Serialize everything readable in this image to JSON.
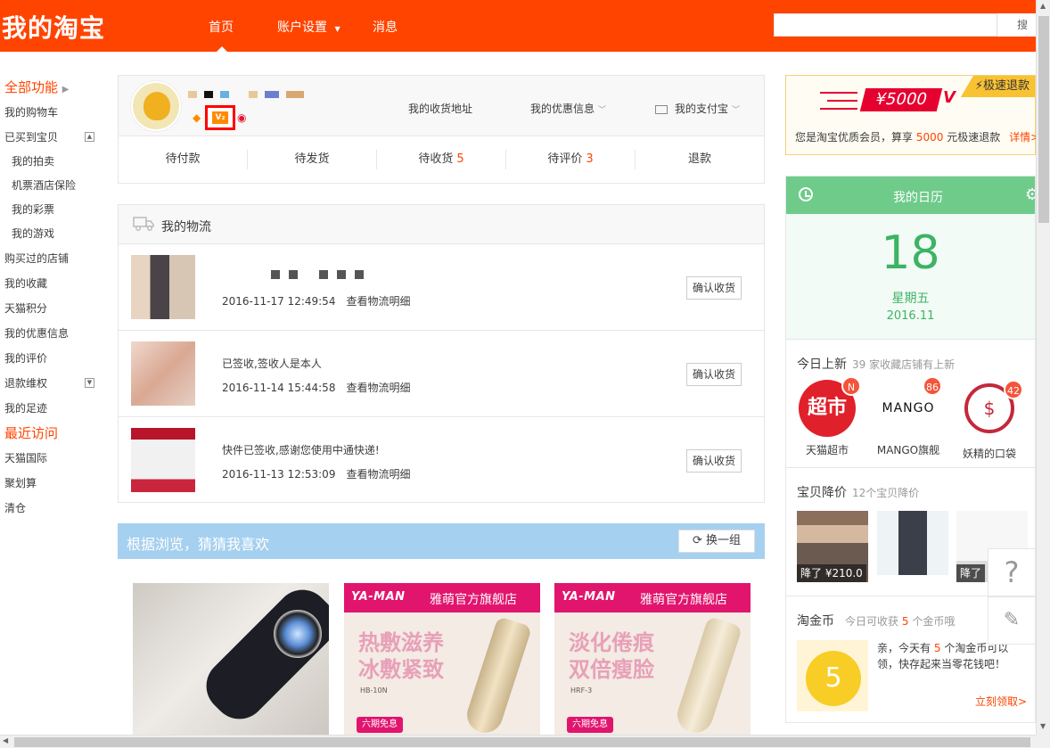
{
  "header": {
    "logo": "我的淘宝",
    "nav": [
      {
        "label": "首页",
        "active": true
      },
      {
        "label": "账户设置",
        "dropdown": true
      },
      {
        "label": "消息"
      }
    ],
    "search_button": "搜 索",
    "brand_color": "#ff4400"
  },
  "sidebar": {
    "section1": "全部功能",
    "items": [
      "我的购物车",
      "已买到宝贝",
      "我的拍卖",
      "机票酒店保险",
      "我的彩票",
      "我的游戏",
      "购买过的店铺",
      "我的收藏",
      "天猫积分",
      "我的优惠信息",
      "我的评价",
      "退款维权",
      "我的足迹"
    ],
    "section2": "最近访问",
    "recent": [
      "天猫国际",
      "聚划算",
      "清仓"
    ]
  },
  "profile": {
    "vip_badge": "V₂",
    "links": {
      "address": "我的收货地址",
      "coupons": "我的优惠信息",
      "alipay": "我的支付宝"
    },
    "order_tabs": [
      {
        "label": "待付款",
        "count": ""
      },
      {
        "label": "待发货",
        "count": ""
      },
      {
        "label": "待收货",
        "count": "5"
      },
      {
        "label": "待评价",
        "count": "3"
      },
      {
        "label": "退款",
        "count": ""
      }
    ]
  },
  "logistics": {
    "title": "我的物流",
    "detail_link": "查看物流明细",
    "confirm": "确认收货",
    "rows": [
      {
        "message": "",
        "time": "2016-11-17 12:49:54"
      },
      {
        "message": "已签收,签收人是本人",
        "time": "2016-11-14 15:44:58"
      },
      {
        "message": "快件已签收,感谢您使用中通快递!",
        "time": "2016-11-13 12:53:09"
      }
    ]
  },
  "guess": {
    "title": "根据浏览，猜猜我喜欢",
    "refresh": "换一组",
    "products": [
      {},
      {
        "brand": "YA-MAN",
        "store": "雅萌官方旗舰店",
        "slogan1": "热敷滋养",
        "slogan2": "冰敷紧致",
        "model": "HB-10N",
        "promo": "六期免息"
      },
      {
        "brand": "YA-MAN",
        "store": "雅萌官方旗舰店",
        "slogan1": "淡化倦痕",
        "slogan2": "双倍瘦脸",
        "model": "HRF-3",
        "promo": "六期免息"
      }
    ]
  },
  "refund": {
    "corner": "极速退款",
    "amount": "¥5000",
    "text_pre": "您是淘宝优质会员，算享",
    "text_amt": "5000",
    "text_post": "元极速退款",
    "more": "详情>"
  },
  "calendar": {
    "title": "我的日历",
    "day": "18",
    "weekday": "星期五",
    "month": "2016.11"
  },
  "new_today": {
    "title": "今日上新",
    "sub_count": "39",
    "sub_text": "家收藏店铺有上新",
    "shops": [
      {
        "name": "天猫超市",
        "badge": "N",
        "logo_text": "超市"
      },
      {
        "name": "MANGO旗舰",
        "badge": "86",
        "logo_text": "MANGO"
      },
      {
        "name": "妖精的口袋",
        "badge": "42",
        "logo_text": "$"
      }
    ]
  },
  "price_drop": {
    "title": "宝贝降价",
    "sub": "12个宝贝降价",
    "items": [
      {
        "label": "降了 ¥210.0"
      },
      {
        "label": ""
      },
      {
        "label": "降了"
      }
    ]
  },
  "coins": {
    "title": "淘金币",
    "sub_pre": "今日可收获",
    "sub_num": "5",
    "sub_post": "个金币哦",
    "amount": "5",
    "text_pre": "亲，今天有",
    "text_num": "5",
    "text_post": "个淘金币可以领，快存起来当零花钱吧！",
    "link": "立刻领取>"
  },
  "floats": {
    "help": "?",
    "edit": "✎"
  }
}
